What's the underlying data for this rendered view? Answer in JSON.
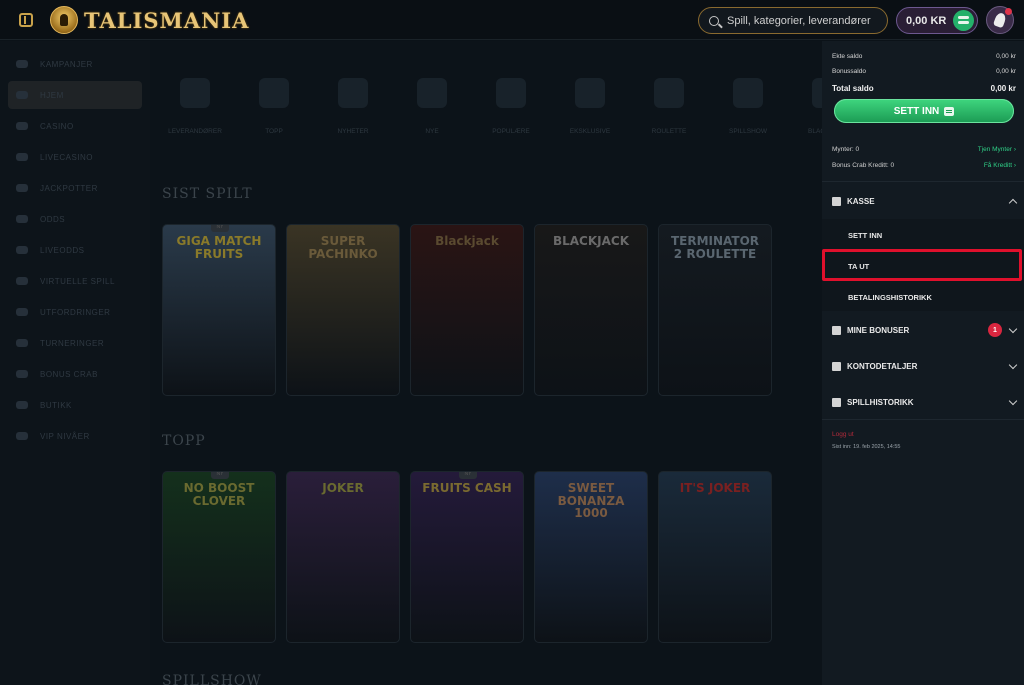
{
  "header": {
    "logo_text": "TALISMANIA",
    "search_placeholder": "Spill, kategorier, leverandører",
    "balance": "0,00 KR"
  },
  "sidebar": {
    "items": [
      {
        "label": "KAMPANJER"
      },
      {
        "label": "HJEM"
      },
      {
        "label": "CASINO"
      },
      {
        "label": "LIVECASINO"
      },
      {
        "label": "JACKPOTTER"
      },
      {
        "label": "ODDS"
      },
      {
        "label": "LIVEODDS"
      },
      {
        "label": "VIRTUELLE SPILL"
      },
      {
        "label": "UTFORDRINGER"
      },
      {
        "label": "TURNERINGER"
      },
      {
        "label": "BONUS CRAB"
      },
      {
        "label": "BUTIKK"
      },
      {
        "label": "VIP NIVÅER"
      }
    ]
  },
  "main": {
    "categories": [
      {
        "label": "LEVERANDØRER"
      },
      {
        "label": "TOPP"
      },
      {
        "label": "NYHETER"
      },
      {
        "label": "NYE"
      },
      {
        "label": "POPULÆRE"
      },
      {
        "label": "EKSKLUSIVE"
      },
      {
        "label": "ROULETTE"
      },
      {
        "label": "SPILLSHOW"
      },
      {
        "label": "BLACKJACK"
      }
    ],
    "section_recent": "SIST SPILT",
    "section_top": "TOPP",
    "section_next": "SPILLSHOW",
    "recent_games": [
      {
        "title": "GIGA MATCH FRUITS",
        "badge": "NY",
        "bg": "#2a3a4a",
        "fg": "#8a7a2a"
      },
      {
        "title": "SUPER PACHINKO",
        "badge": "",
        "bg": "#3a3424",
        "fg": "#6a5a3a"
      },
      {
        "title": "Blackjack",
        "badge": "",
        "bg": "#2a1414",
        "fg": "#5a4a30"
      },
      {
        "title": "BLACKJACK",
        "badge": "",
        "bg": "#181818",
        "fg": "#6a6a6a"
      },
      {
        "title": "TERMINATOR 2 ROULETTE",
        "badge": "",
        "bg": "#141a20",
        "fg": "#5a6670"
      }
    ],
    "top_games": [
      {
        "title": "NO BOOST CLOVER",
        "badge": "NY",
        "bg": "#14301c",
        "fg": "#6a6a30"
      },
      {
        "title": "JOKER",
        "badge": "",
        "bg": "#2a1e3a",
        "fg": "#6a6a30"
      },
      {
        "title": "FRUITS CASH",
        "badge": "NY",
        "bg": "#241a3a",
        "fg": "#7a6a30"
      },
      {
        "title": "SWEET BONANZA 1000",
        "badge": "",
        "bg": "#1e2e4a",
        "fg": "#7a5a40"
      },
      {
        "title": "IT'S JOKER",
        "badge": "",
        "bg": "#1a2a3a",
        "fg": "#7a2020"
      }
    ]
  },
  "panel": {
    "cash_label": "Ekte saldo",
    "cash_value": "0,00 kr",
    "bonus_label": "Bonussaldo",
    "bonus_value": "0,00 kr",
    "total_label": "Total saldo",
    "total_value": "0,00 kr",
    "deposit_button": "SETT INN",
    "coins_label": "Mynter: 0",
    "coins_link": "Tjen Mynter",
    "crab_label": "Bonus Crab Kreditt: 0",
    "crab_link": "Få Kreditt",
    "kasse": "KASSE",
    "kasse_items": [
      "SETT INN",
      "TA UT",
      "BETALINGSHISTORIKK"
    ],
    "bonuses": "MINE BONUSER",
    "bonuses_count": "1",
    "account": "KONTODETALJER",
    "history": "SPILLHISTORIKK",
    "logout": "Logg ut",
    "session": "Sist inn: 19. feb 2025, 14:55"
  }
}
